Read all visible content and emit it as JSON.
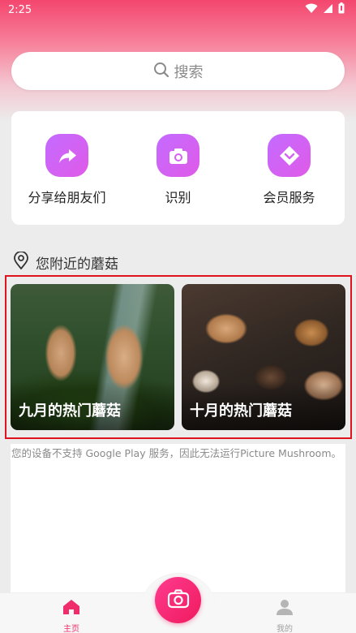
{
  "status_bar": {
    "time": "2:25",
    "icons": [
      "wifi-icon",
      "signal-icon",
      "battery-icon"
    ]
  },
  "search": {
    "label": "搜索",
    "icon": "search-icon"
  },
  "actions": [
    {
      "label": "分享给朋友们",
      "icon": "share-arrow-icon"
    },
    {
      "label": "识别",
      "icon": "camera-icon"
    },
    {
      "label": "会员服务",
      "icon": "heart-badge-icon"
    }
  ],
  "nearby": {
    "title": "您附近的蘑菇",
    "icon": "location-pin-icon",
    "cards": [
      {
        "title": "九月的热门蘑菇"
      },
      {
        "title": "十月的热门蘑菇"
      }
    ]
  },
  "notice": {
    "text": "您的设备不支持 Google Play 服务，因此无法运行Picture Mushroom。"
  },
  "bottom_nav": {
    "items": [
      {
        "label": "主页",
        "icon": "home-icon",
        "active": true
      },
      {
        "label": "我的",
        "icon": "person-icon",
        "active": false
      }
    ],
    "fab_icon": "camera-icon"
  },
  "colors": {
    "accent": "#ef2d6a",
    "action_gradient_start": "#c36bff",
    "action_gradient_end": "#e05ae8",
    "highlight_border": "#e0141e"
  }
}
